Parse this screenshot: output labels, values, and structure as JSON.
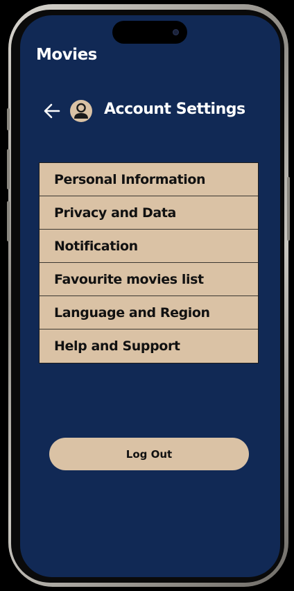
{
  "app": {
    "title": "Movies"
  },
  "header": {
    "title": "Account Settings",
    "back_icon": "arrow-left-icon",
    "avatar_icon": "user-avatar-icon"
  },
  "menu": {
    "items": [
      {
        "label": "Personal Information"
      },
      {
        "label": "Privacy and Data"
      },
      {
        "label": "Notification"
      },
      {
        "label": "Favourite movies list"
      },
      {
        "label": "Language and Region"
      },
      {
        "label": "Help and Support"
      }
    ]
  },
  "logout": {
    "label": "Log Out"
  },
  "colors": {
    "background": "#112955",
    "accent": "#dac2a5",
    "text_light": "#ffffff",
    "text_dark": "#111111"
  }
}
